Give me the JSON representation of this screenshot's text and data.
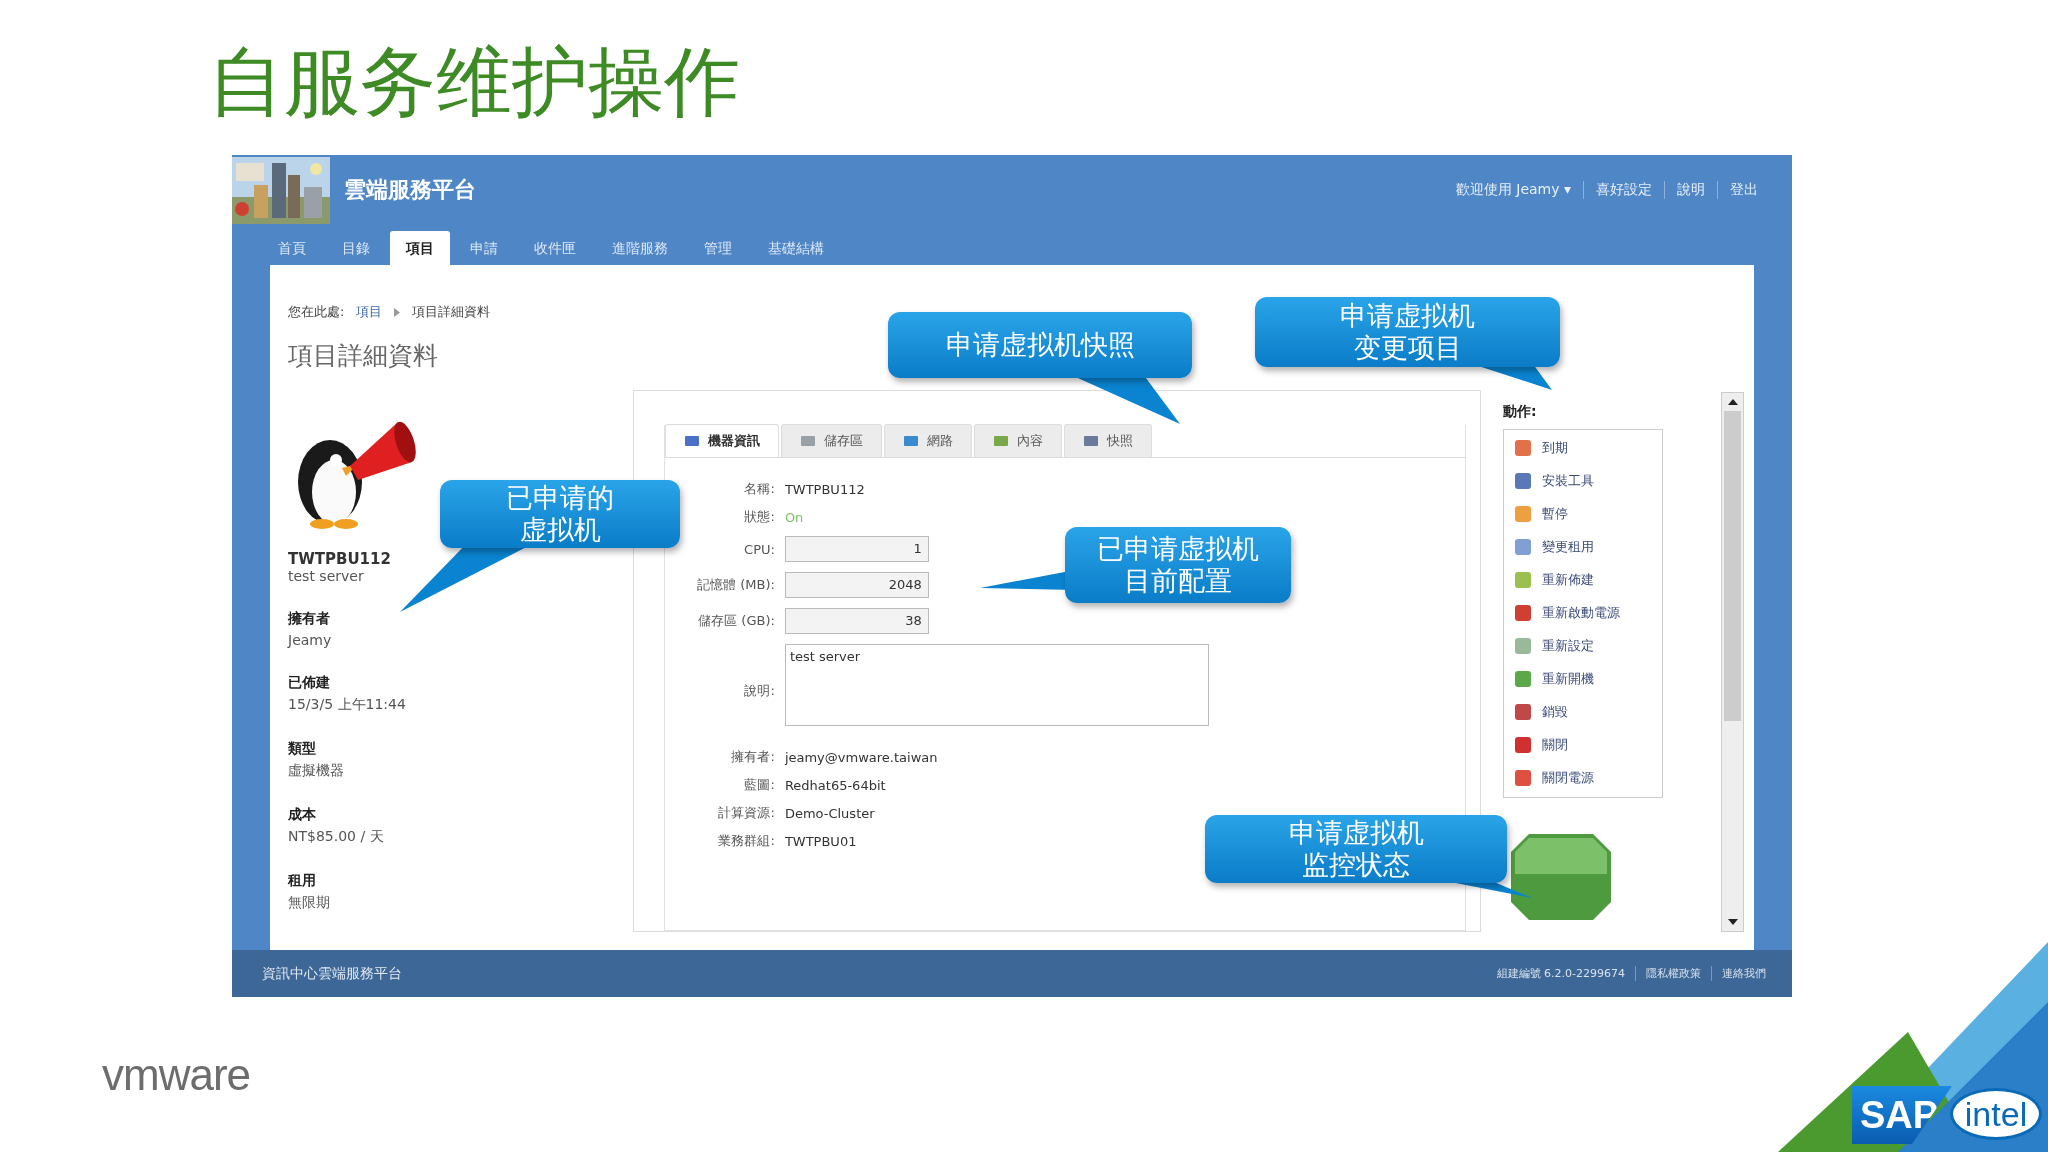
{
  "slide": {
    "title": "自服务维护操作"
  },
  "portal": {
    "app_name": "雲端服務平台",
    "user_menu": "歡迎使用 Jeamy ▾",
    "header_links": [
      "喜好設定",
      "說明",
      "登出"
    ],
    "nav_tabs": [
      {
        "label": "首頁",
        "selected": false
      },
      {
        "label": "目錄",
        "selected": false
      },
      {
        "label": "項目",
        "selected": true
      },
      {
        "label": "申請",
        "selected": false
      },
      {
        "label": "收件匣",
        "selected": false
      },
      {
        "label": "進階服務",
        "selected": false
      },
      {
        "label": "管理",
        "selected": false
      },
      {
        "label": "基礎結構",
        "selected": false
      }
    ],
    "breadcrumb": {
      "label": "您在此處:",
      "items": [
        "項目",
        "項目詳細資料"
      ]
    },
    "page_title": "項目詳細資料",
    "item": {
      "name": "TWTPBU112",
      "description": "test server",
      "properties": [
        {
          "label": "擁有者",
          "value": "Jeamy"
        },
        {
          "label": "已佈建",
          "value": "15/3/5 上午11:44"
        },
        {
          "label": "類型",
          "value": "虛擬機器"
        },
        {
          "label": "成本",
          "value": "NT$85.00 / 天"
        },
        {
          "label": "租用",
          "value": "無限期"
        }
      ]
    },
    "detail_tabs": [
      {
        "label": "機器資訊",
        "selected": true
      },
      {
        "label": "儲存區",
        "selected": false
      },
      {
        "label": "網路",
        "selected": false
      },
      {
        "label": "內容",
        "selected": false
      },
      {
        "label": "快照",
        "selected": false
      }
    ],
    "fields": [
      {
        "kind": "text",
        "label": "名稱:",
        "value": "TWTPBU112"
      },
      {
        "kind": "status",
        "label": "狀態:",
        "value": "On"
      },
      {
        "kind": "input",
        "label": "CPU:",
        "value": "1"
      },
      {
        "kind": "input",
        "label": "記憶體 (MB):",
        "value": "2048"
      },
      {
        "kind": "input",
        "label": "儲存區 (GB):",
        "value": "38"
      },
      {
        "kind": "textarea",
        "label": "說明:",
        "value": "test server"
      },
      {
        "kind": "text",
        "label": "擁有者:",
        "value": "jeamy@vmware.taiwan"
      },
      {
        "kind": "text",
        "label": "藍圖:",
        "value": "Redhat65-64bit"
      },
      {
        "kind": "text",
        "label": "計算資源:",
        "value": "Demo-Cluster"
      },
      {
        "kind": "text",
        "label": "業務群組:",
        "value": "TWTPBU01"
      }
    ],
    "actions": {
      "title": "動作:",
      "items": [
        "到期",
        "安裝工具",
        "暫停",
        "變更租用",
        "重新佈建",
        "重新啟動電源",
        "重新設定",
        "重新開機",
        "銷毀",
        "關閉",
        "關閉電源"
      ]
    },
    "footer": {
      "title": "資訊中心雲端服務平台",
      "links": [
        "組建編號 6.2.0-2299674",
        "隱私權政策",
        "連絡我們"
      ]
    }
  },
  "callouts": [
    {
      "lines": [
        "申请虚拟机快照"
      ]
    },
    {
      "lines": [
        "申请虚拟机",
        "变更项目"
      ]
    },
    {
      "lines": [
        "已申请的",
        "虚拟机"
      ]
    },
    {
      "lines": [
        "已申请虚拟机",
        "目前配置"
      ]
    },
    {
      "lines": [
        "申请虚拟机",
        "监控状态"
      ]
    }
  ],
  "logos": [
    "vmware",
    "SAP",
    "intel"
  ]
}
